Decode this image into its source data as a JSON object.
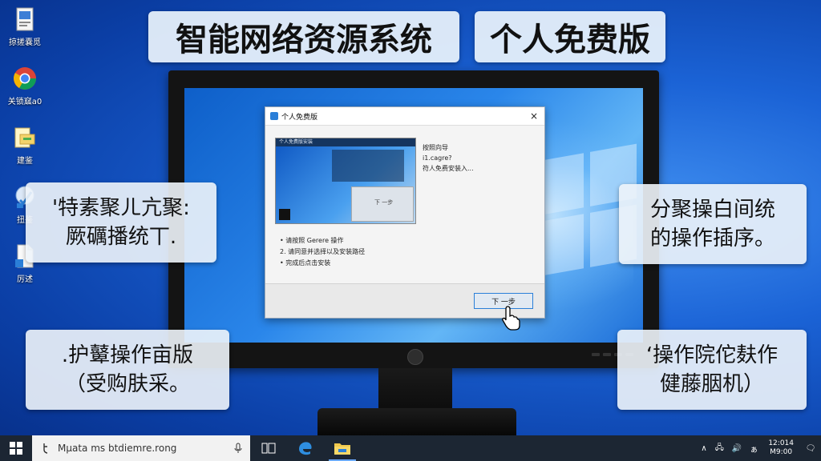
{
  "banners": [
    "智能网络资源系统",
    "个人免费版"
  ],
  "desktop_icons": [
    {
      "label": "掠搓嚢觅",
      "icon": "document-icon"
    },
    {
      "label": "关锁窳a0",
      "icon": "chrome-icon"
    },
    {
      "label": "建鉴",
      "icon": "folder-icon"
    },
    {
      "label": "扭鉴",
      "icon": "network-icon"
    },
    {
      "label": "厉述",
      "icon": "file-icon"
    }
  ],
  "dialog": {
    "title": "个人免费版",
    "close_glyph": "×",
    "preview_title": "个人免费版安装",
    "preview_window_text": "下 一步",
    "right_text": [
      "按照向导",
      "i1.cagre?",
      "符人免费安装入..."
    ],
    "steps": [
      "• 请按照 Gerere 操作",
      "2. 请同意并选择以及安装路径",
      "• 完成后点击安装"
    ],
    "next_button": "下 一步"
  },
  "callouts": [
    [
      "'特素聚ㄦ亢聚:",
      "厥礪播统丅."
    ],
    [
      "分聚操白间统",
      "的操作插序。"
    ],
    [
      ".护鼙操作亩版",
      "（受购肤采。"
    ],
    [
      "‘操作院佗麸作",
      "健藤胭机）"
    ]
  ],
  "taskbar": {
    "search_text": "Mµata ms btdiemre.rong",
    "tray_glyphs": [
      "∧",
      "🖧",
      "🔊",
      "ぁ"
    ],
    "clock_time": "12:014",
    "clock_date": "M9:00",
    "notif_glyph": "🗨"
  },
  "colors": {
    "accent": "#2b7fd8",
    "taskbar": "#1c2633"
  }
}
